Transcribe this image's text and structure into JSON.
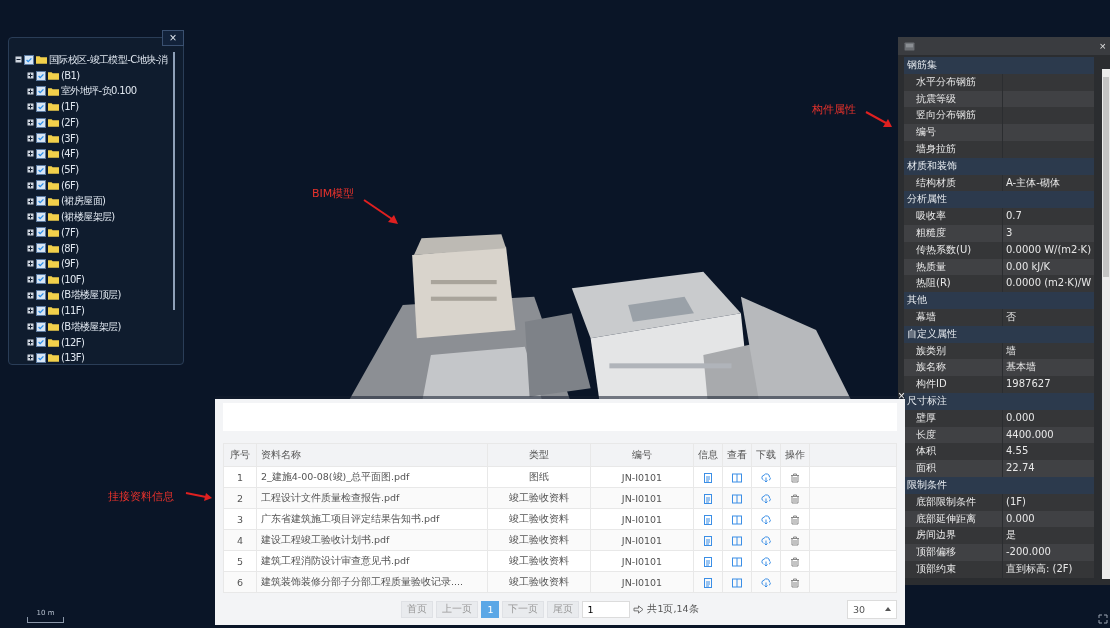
{
  "tree": {
    "label": "国际校区-竣工模型-C地块-消",
    "checked": true,
    "expanded": true,
    "children": [
      {
        "label": "(B1)",
        "checked": true,
        "expanded": false
      },
      {
        "label": "室外地坪-负0.100",
        "checked": true,
        "expanded": false
      },
      {
        "label": "(1F)",
        "checked": true,
        "expanded": false
      },
      {
        "label": "(2F)",
        "checked": true,
        "expanded": false
      },
      {
        "label": "(3F)",
        "checked": true,
        "expanded": false
      },
      {
        "label": "(4F)",
        "checked": true,
        "expanded": false
      },
      {
        "label": "(5F)",
        "checked": true,
        "expanded": false
      },
      {
        "label": "(6F)",
        "checked": true,
        "expanded": false
      },
      {
        "label": "(裙房屋面)",
        "checked": true,
        "expanded": false
      },
      {
        "label": "(裙楼屋架层)",
        "checked": true,
        "expanded": false
      },
      {
        "label": "(7F)",
        "checked": true,
        "expanded": false
      },
      {
        "label": "(8F)",
        "checked": true,
        "expanded": false
      },
      {
        "label": "(9F)",
        "checked": true,
        "expanded": false
      },
      {
        "label": "(10F)",
        "checked": true,
        "expanded": false
      },
      {
        "label": "(B塔楼屋顶层)",
        "checked": true,
        "expanded": false
      },
      {
        "label": "(11F)",
        "checked": true,
        "expanded": false
      },
      {
        "label": "(B塔楼屋架层)",
        "checked": true,
        "expanded": false
      },
      {
        "label": "(12F)",
        "checked": true,
        "expanded": false
      },
      {
        "label": "(13F)",
        "checked": true,
        "expanded": false
      }
    ]
  },
  "close_label": "×",
  "annotations": [
    {
      "text": "BIM模型"
    },
    {
      "text": "构件属性"
    },
    {
      "text": "挂接资料信息"
    }
  ],
  "properties": [
    {
      "group": "钢筋集",
      "items": [
        {
          "name": "水平分布钢筋"
        },
        {
          "name": "抗震等级"
        },
        {
          "name": "竖向分布钢筋"
        },
        {
          "name": "编号"
        },
        {
          "name": "墙身拉筋"
        }
      ]
    },
    {
      "group": "材质和装饰",
      "items": [
        {
          "name": "结构材质",
          "value": "A-主体-砌体"
        }
      ]
    },
    {
      "group": "分析属性",
      "items": [
        {
          "name": "吸收率",
          "value": "0.7"
        },
        {
          "name": "粗糙度",
          "value": "3"
        },
        {
          "name": "传热系数(U)",
          "value": "0.0000 W/(m2·K)"
        },
        {
          "name": "热质量",
          "value": "0.00 kJ/K"
        },
        {
          "name": "热阻(R)",
          "value": "0.0000 (m2·K)/W"
        }
      ]
    },
    {
      "group": "其他",
      "items": [
        {
          "name": "幕墙",
          "value": "否"
        }
      ]
    },
    {
      "group": "自定义属性",
      "items": [
        {
          "name": "族类别",
          "value": "墙"
        },
        {
          "name": "族名称",
          "value": "基本墙"
        },
        {
          "name": "构件ID",
          "value": "1987627"
        }
      ]
    },
    {
      "group": "尺寸标注",
      "items": [
        {
          "name": "壁厚",
          "value": "0.000"
        },
        {
          "name": "长度",
          "value": "4400.000"
        },
        {
          "name": "体积",
          "value": "4.55"
        },
        {
          "name": "面积",
          "value": "22.74"
        }
      ]
    },
    {
      "group": "限制条件",
      "items": [
        {
          "name": "底部限制条件",
          "value": "(1F)"
        },
        {
          "name": "底部延伸距离",
          "value": "0.000"
        },
        {
          "name": "房间边界",
          "value": "是"
        },
        {
          "name": "顶部偏移",
          "value": "-200.000"
        },
        {
          "name": "顶部约束",
          "value": "直到标高: (2F)"
        }
      ]
    }
  ],
  "table": {
    "columns": [
      "序号",
      "资料名称",
      "类型",
      "编号",
      "信息",
      "查看",
      "下载",
      "操作"
    ],
    "rows": [
      [
        "1",
        "2_建施4-00-08(竣)_总平面图.pdf",
        "图纸",
        "JN-I0101"
      ],
      [
        "2",
        "工程设计文件质量检查报告.pdf",
        "竣工验收资料",
        "JN-I0101"
      ],
      [
        "3",
        "广东省建筑施工项目评定结果告知书.pdf",
        "竣工验收资料",
        "JN-I0101"
      ],
      [
        "4",
        "建设工程竣工验收计划书.pdf",
        "竣工验收资料",
        "JN-I0101"
      ],
      [
        "5",
        "建筑工程消防设计审查意见书.pdf",
        "竣工验收资料",
        "JN-I0101"
      ],
      [
        "6",
        "建筑装饰装修分部子分部工程质量验收记录....",
        "竣工验收资料",
        "JN-I0101"
      ]
    ]
  },
  "pager": {
    "buttons": [
      {
        "label": "首页",
        "selected": false
      },
      {
        "label": "上一页",
        "selected": false
      },
      {
        "label": "1",
        "selected": true
      },
      {
        "label": "下一页",
        "selected": false
      },
      {
        "label": "尾页",
        "selected": false
      }
    ],
    "page_input": "1",
    "summary": "共1页,14条",
    "page_size": "30"
  },
  "scale": "10 m"
}
